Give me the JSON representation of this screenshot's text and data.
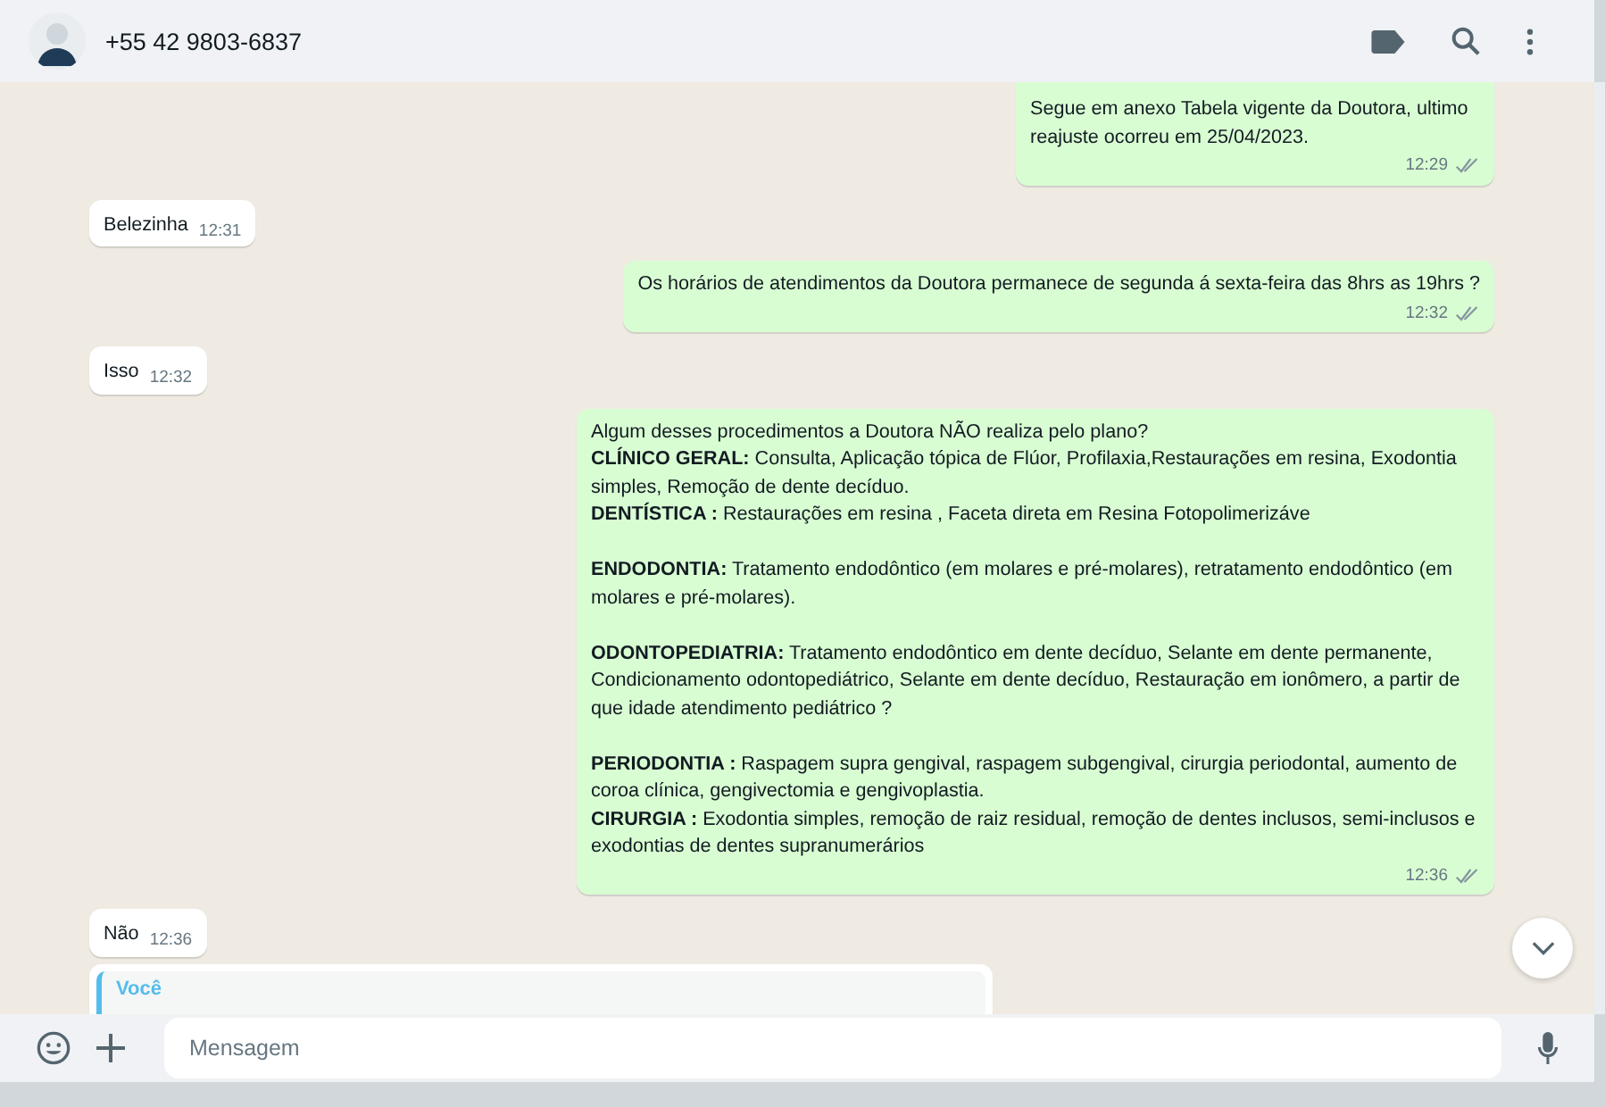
{
  "header": {
    "contact": "+55 42 9803-6837"
  },
  "messages": [
    {
      "kind": "document",
      "outgoing": true,
      "caption": "Segue em anexo Tabela vigente da Doutora, ultimo reajuste ocorreu em 25/04/2023.",
      "time": "12:29",
      "read": false
    },
    {
      "kind": "text",
      "outgoing": false,
      "blocks": [
        [
          "Belezinha"
        ]
      ],
      "time": "12:31"
    },
    {
      "kind": "text",
      "outgoing": true,
      "blocks": [
        [
          "Os horários de atendimentos da Doutora permanece de segunda á sexta-feira das 8hrs as 19hrs ?"
        ]
      ],
      "time": "12:32",
      "read": false
    },
    {
      "kind": "text",
      "outgoing": false,
      "blocks": [
        [
          "Isso"
        ]
      ],
      "time": "12:32"
    },
    {
      "kind": "text",
      "outgoing": true,
      "blocks": [
        [
          "Algum desses procedimentos a Doutora NÃO realiza pelo plano?",
          "**CLÍNICO GERAL:** Consulta, Aplicação tópica de Flúor, Profilaxia,Restaurações em resina, Exodontia simples, Remoção de dente decíduo.",
          "**DENTÍSTICA :** Restaurações em resina , Faceta direta em Resina Fotopolimerizáve"
        ],
        [
          "**ENDODONTIA:** Tratamento endodôntico (em molares e pré-molares), retratamento endodôntico (em molares e pré-molares)."
        ],
        [
          "**ODONTOPEDIATRIA:** Tratamento endodôntico em dente decíduo, Selante em dente permanente, Condicionamento odontopediátrico, Selante em dente decíduo, Restauração em ionômero, a partir de que idade atendimento pediátrico ?"
        ],
        [
          "**PERIODONTIA :** Raspagem supra gengival, raspagem subgengival, cirurgia periodontal, aumento de coroa clínica, gengivectomia e gengivoplastia.",
          "**CIRURGIA :** Exodontia simples, remoção de raiz residual, remoção de dentes inclusos, semi-inclusos e exodontias de dentes supranumerários"
        ]
      ],
      "time": "12:36",
      "read": false
    },
    {
      "kind": "text",
      "outgoing": false,
      "blocks": [
        [
          "Não"
        ]
      ],
      "time": "12:36"
    },
    {
      "kind": "reply",
      "outgoing": false,
      "quote_author": "Você"
    }
  ],
  "composer": {
    "placeholder": "Mensagem"
  }
}
